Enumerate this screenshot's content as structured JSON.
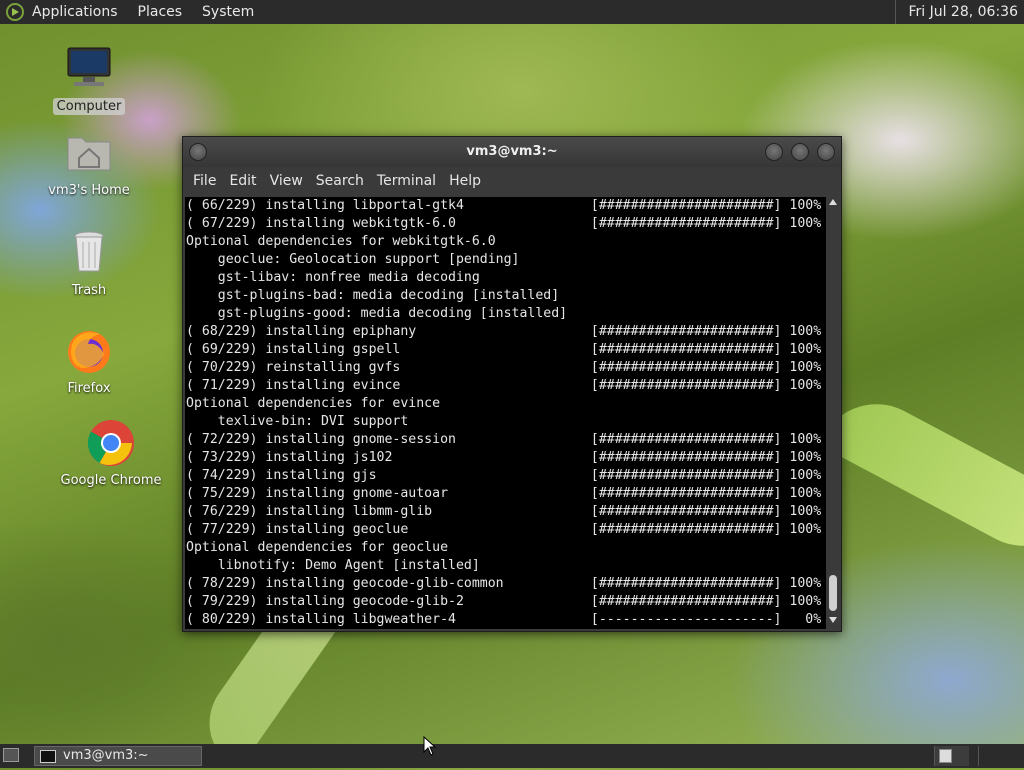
{
  "top_panel": {
    "menus": [
      "Applications",
      "Places",
      "System"
    ],
    "clock": "Fri Jul 28, 06:36"
  },
  "desktop_icons": [
    {
      "label": "Computer",
      "icon": "computer-icon"
    },
    {
      "label": "vm3's Home",
      "icon": "home-folder-icon"
    },
    {
      "label": "Trash",
      "icon": "trash-icon"
    },
    {
      "label": "Firefox",
      "icon": "firefox-icon"
    },
    {
      "label": "Google Chrome",
      "icon": "chrome-icon"
    }
  ],
  "terminal": {
    "title": "vm3@vm3:~",
    "menu": [
      "File",
      "Edit",
      "View",
      "Search",
      "Terminal",
      "Help"
    ],
    "lines": [
      "( 66/229) installing libportal-gtk4                [######################] 100%",
      "( 67/229) installing webkitgtk-6.0                 [######################] 100%",
      "Optional dependencies for webkitgtk-6.0",
      "    geoclue: Geolocation support [pending]",
      "    gst-libav: nonfree media decoding",
      "    gst-plugins-bad: media decoding [installed]",
      "    gst-plugins-good: media decoding [installed]",
      "( 68/229) installing epiphany                      [######################] 100%",
      "( 69/229) installing gspell                        [######################] 100%",
      "( 70/229) reinstalling gvfs                        [######################] 100%",
      "( 71/229) installing evince                        [######################] 100%",
      "Optional dependencies for evince",
      "    texlive-bin: DVI support",
      "( 72/229) installing gnome-session                 [######################] 100%",
      "( 73/229) installing js102                         [######################] 100%",
      "( 74/229) installing gjs                           [######################] 100%",
      "( 75/229) installing gnome-autoar                  [######################] 100%",
      "( 76/229) installing libmm-glib                    [######################] 100%",
      "( 77/229) installing geoclue                       [######################] 100%",
      "Optional dependencies for geoclue",
      "    libnotify: Demo Agent [installed]",
      "( 78/229) installing geocode-glib-common           [######################] 100%",
      "( 79/229) installing geocode-glib-2                [######################] 100%",
      "( 80/229) installing libgweather-4                 [----------------------]   0%"
    ]
  },
  "taskbar": {
    "task_label": "vm3@vm3:~",
    "workspaces": 2
  },
  "colors": {
    "panel_bg": "#2b2b2b",
    "terminal_bg": "#000000",
    "terminal_fg": "#e6e6e6"
  }
}
